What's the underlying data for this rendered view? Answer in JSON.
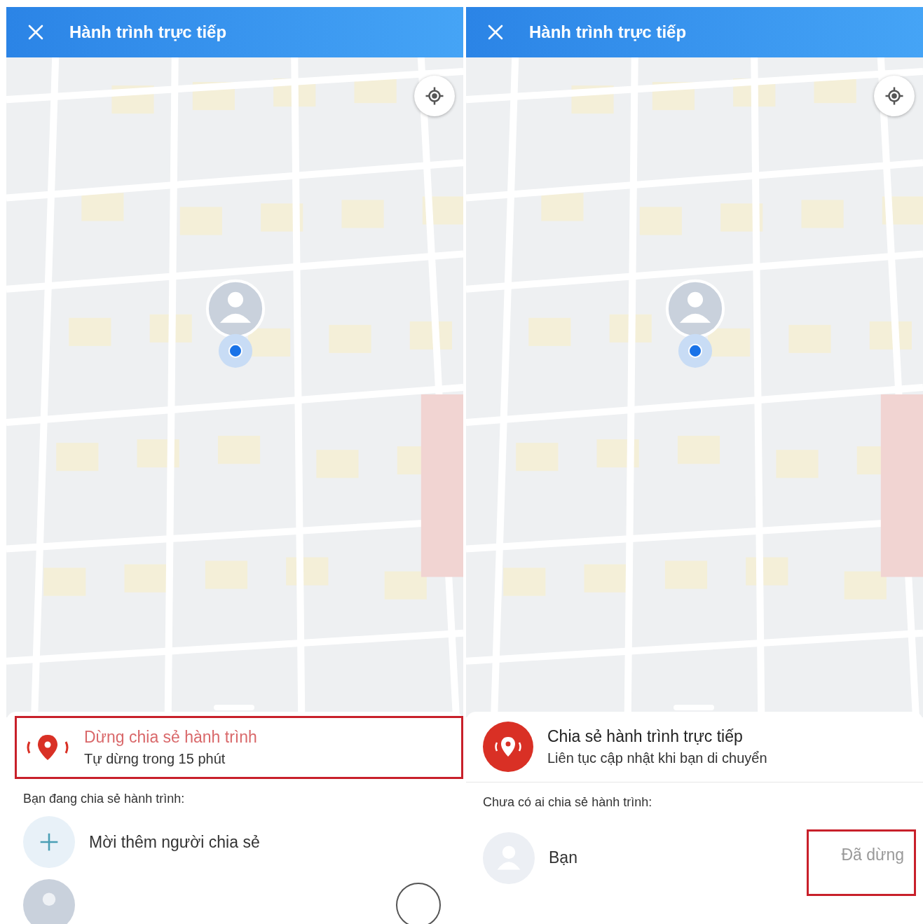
{
  "screens": [
    {
      "header": {
        "title": "Hành trình trực tiếp"
      },
      "share_card": {
        "title": "Dừng chia sẻ hành trình",
        "subtitle": "Tự dừng trong 15 phút",
        "active": true,
        "highlighted": true
      },
      "section_label": "Bạn đang chia sẻ hành trình:",
      "people": [
        {
          "kind": "invite",
          "name": "Mời thêm người chia sẻ"
        },
        {
          "kind": "partial"
        }
      ]
    },
    {
      "header": {
        "title": "Hành trình trực tiếp"
      },
      "share_card": {
        "title": "Chia sẻ hành trình trực tiếp",
        "subtitle": "Liên tục cập nhật khi bạn di chuyển",
        "active": false,
        "highlighted": false
      },
      "section_label": "Chưa có ai chia sẻ hành trình:",
      "people": [
        {
          "kind": "person",
          "name": "Bạn",
          "status": "Đã dừng",
          "highlighted": true
        }
      ]
    }
  ]
}
